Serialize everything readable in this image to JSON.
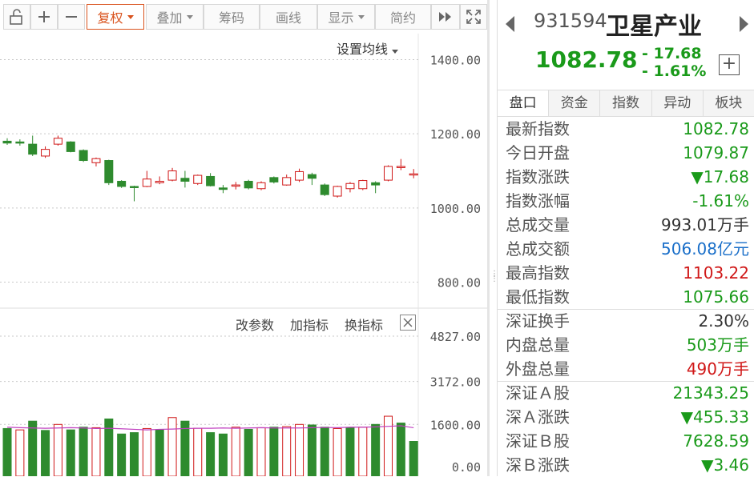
{
  "toolbar": {
    "buttons": [
      "复权",
      "叠加",
      "筹码",
      "画线",
      "显示",
      "简约"
    ],
    "icons": [
      "unlock-icon",
      "zoom-in-icon",
      "zoom-out-icon",
      "fast-forward-icon",
      "fullscreen-icon"
    ]
  },
  "chart": {
    "ma_setting": "设置均线",
    "price_ticks": [
      "1400.00",
      "1200.00",
      "1000.00",
      "800.00"
    ],
    "volume_controls": [
      "改参数",
      "加指标",
      "换指标"
    ],
    "volume_ticks": [
      "4827.00",
      "3172.00",
      "1600.00",
      "0.00"
    ]
  },
  "chart_data": {
    "type": "candlestick",
    "price_ylim": [
      730,
      1470
    ],
    "candles": [
      {
        "o": 1180,
        "c": 1175,
        "h": 1188,
        "l": 1170
      },
      {
        "o": 1178,
        "c": 1176,
        "h": 1185,
        "l": 1168
      },
      {
        "o": 1172,
        "c": 1145,
        "h": 1195,
        "l": 1140
      },
      {
        "o": 1140,
        "c": 1158,
        "h": 1166,
        "l": 1135
      },
      {
        "o": 1172,
        "c": 1188,
        "h": 1195,
        "l": 1168
      },
      {
        "o": 1178,
        "c": 1152,
        "h": 1180,
        "l": 1150
      },
      {
        "o": 1155,
        "c": 1128,
        "h": 1158,
        "l": 1124
      },
      {
        "o": 1122,
        "c": 1133,
        "h": 1136,
        "l": 1112
      },
      {
        "o": 1128,
        "c": 1068,
        "h": 1130,
        "l": 1062
      },
      {
        "o": 1072,
        "c": 1058,
        "h": 1075,
        "l": 1054
      },
      {
        "o": 1058,
        "c": 1055,
        "h": 1060,
        "l": 1018
      },
      {
        "o": 1058,
        "c": 1078,
        "h": 1100,
        "l": 1056
      },
      {
        "o": 1068,
        "c": 1072,
        "h": 1085,
        "l": 1064
      },
      {
        "o": 1075,
        "c": 1100,
        "h": 1108,
        "l": 1072
      },
      {
        "o": 1080,
        "c": 1072,
        "h": 1100,
        "l": 1055
      },
      {
        "o": 1066,
        "c": 1088,
        "h": 1090,
        "l": 1062
      },
      {
        "o": 1085,
        "c": 1060,
        "h": 1094,
        "l": 1058
      },
      {
        "o": 1054,
        "c": 1050,
        "h": 1062,
        "l": 1040
      },
      {
        "o": 1060,
        "c": 1062,
        "h": 1070,
        "l": 1050
      },
      {
        "o": 1072,
        "c": 1054,
        "h": 1076,
        "l": 1050
      },
      {
        "o": 1052,
        "c": 1068,
        "h": 1072,
        "l": 1048
      },
      {
        "o": 1082,
        "c": 1070,
        "h": 1085,
        "l": 1066
      },
      {
        "o": 1062,
        "c": 1082,
        "h": 1090,
        "l": 1060
      },
      {
        "o": 1075,
        "c": 1098,
        "h": 1106,
        "l": 1070
      },
      {
        "o": 1090,
        "c": 1080,
        "h": 1095,
        "l": 1062
      },
      {
        "o": 1062,
        "c": 1036,
        "h": 1066,
        "l": 1032
      },
      {
        "o": 1032,
        "c": 1058,
        "h": 1060,
        "l": 1028
      },
      {
        "o": 1052,
        "c": 1066,
        "h": 1070,
        "l": 1042
      },
      {
        "o": 1052,
        "c": 1074,
        "h": 1076,
        "l": 1048
      },
      {
        "o": 1068,
        "c": 1062,
        "h": 1072,
        "l": 1040
      },
      {
        "o": 1075,
        "c": 1112,
        "h": 1115,
        "l": 1072
      },
      {
        "o": 1110,
        "c": 1112,
        "h": 1132,
        "l": 1102
      },
      {
        "o": 1090,
        "c": 1092,
        "h": 1105,
        "l": 1080
      }
    ],
    "volumes": [
      {
        "v": 1450,
        "up": false
      },
      {
        "v": 1400,
        "up": true
      },
      {
        "v": 1720,
        "up": false
      },
      {
        "v": 1380,
        "up": false
      },
      {
        "v": 1600,
        "up": true
      },
      {
        "v": 1400,
        "up": false
      },
      {
        "v": 1500,
        "up": false
      },
      {
        "v": 1480,
        "up": true
      },
      {
        "v": 1800,
        "up": false
      },
      {
        "v": 1250,
        "up": false
      },
      {
        "v": 1300,
        "up": false
      },
      {
        "v": 1450,
        "up": true
      },
      {
        "v": 1400,
        "up": false
      },
      {
        "v": 1850,
        "up": true
      },
      {
        "v": 1720,
        "up": false
      },
      {
        "v": 1460,
        "up": true
      },
      {
        "v": 1300,
        "up": false
      },
      {
        "v": 1250,
        "up": false
      },
      {
        "v": 1500,
        "up": true
      },
      {
        "v": 1420,
        "up": false
      },
      {
        "v": 1480,
        "up": true
      },
      {
        "v": 1500,
        "up": false
      },
      {
        "v": 1520,
        "up": true
      },
      {
        "v": 1600,
        "up": true
      },
      {
        "v": 1580,
        "up": false
      },
      {
        "v": 1500,
        "up": false
      },
      {
        "v": 1450,
        "up": true
      },
      {
        "v": 1480,
        "up": false
      },
      {
        "v": 1500,
        "up": true
      },
      {
        "v": 1600,
        "up": false
      },
      {
        "v": 1900,
        "up": true
      },
      {
        "v": 1650,
        "up": false
      },
      {
        "v": 980,
        "up": false
      }
    ],
    "volume_ma": [
      1500,
      1480,
      1470,
      1460,
      1470,
      1480,
      1470,
      1450,
      1460,
      1440,
      1420,
      1400,
      1420,
      1430,
      1450,
      1460,
      1460,
      1470,
      1460,
      1470,
      1480,
      1470,
      1470,
      1470,
      1480,
      1490,
      1480,
      1500,
      1500,
      1510,
      1530,
      1550,
      1480
    ],
    "volume_ylim": [
      0,
      4827
    ]
  },
  "quote": {
    "code": "931594",
    "name": "卫星产业",
    "price": "1082.78",
    "change": "- 17.68",
    "change_pct": "- 1.61%",
    "tabs": [
      "盘口",
      "资金",
      "指数",
      "异动",
      "板块"
    ],
    "rows": [
      {
        "label": "最新指数",
        "value": "1082.78",
        "color": "green"
      },
      {
        "label": "今日开盘",
        "value": "1079.87",
        "color": "green"
      },
      {
        "label": "指数涨跌",
        "value": "▼17.68",
        "color": "green"
      },
      {
        "label": "指数涨幅",
        "value": "-1.61%",
        "color": "green"
      },
      {
        "label": "总成交量",
        "value": "993.01万手",
        "color": "dark"
      },
      {
        "label": "总成交额",
        "value": "506.08亿元",
        "color": "blue"
      },
      {
        "label": "最高指数",
        "value": "1103.22",
        "color": "red"
      },
      {
        "label": "最低指数",
        "value": "1075.66",
        "color": "green"
      },
      {
        "label": "深证换手",
        "value": "2.30%",
        "color": "dark"
      },
      {
        "label": "内盘总量",
        "value": "503万手",
        "color": "green"
      },
      {
        "label": "外盘总量",
        "value": "490万手",
        "color": "red"
      },
      {
        "label": "深证Ａ股",
        "value": "21343.25",
        "color": "green"
      },
      {
        "label": "深Ａ涨跌",
        "value": "▼455.33",
        "color": "green"
      },
      {
        "label": "深证Ｂ股",
        "value": "7628.59",
        "color": "green"
      },
      {
        "label": "深Ｂ涨跌",
        "value": "▼3.46",
        "color": "green"
      }
    ]
  }
}
